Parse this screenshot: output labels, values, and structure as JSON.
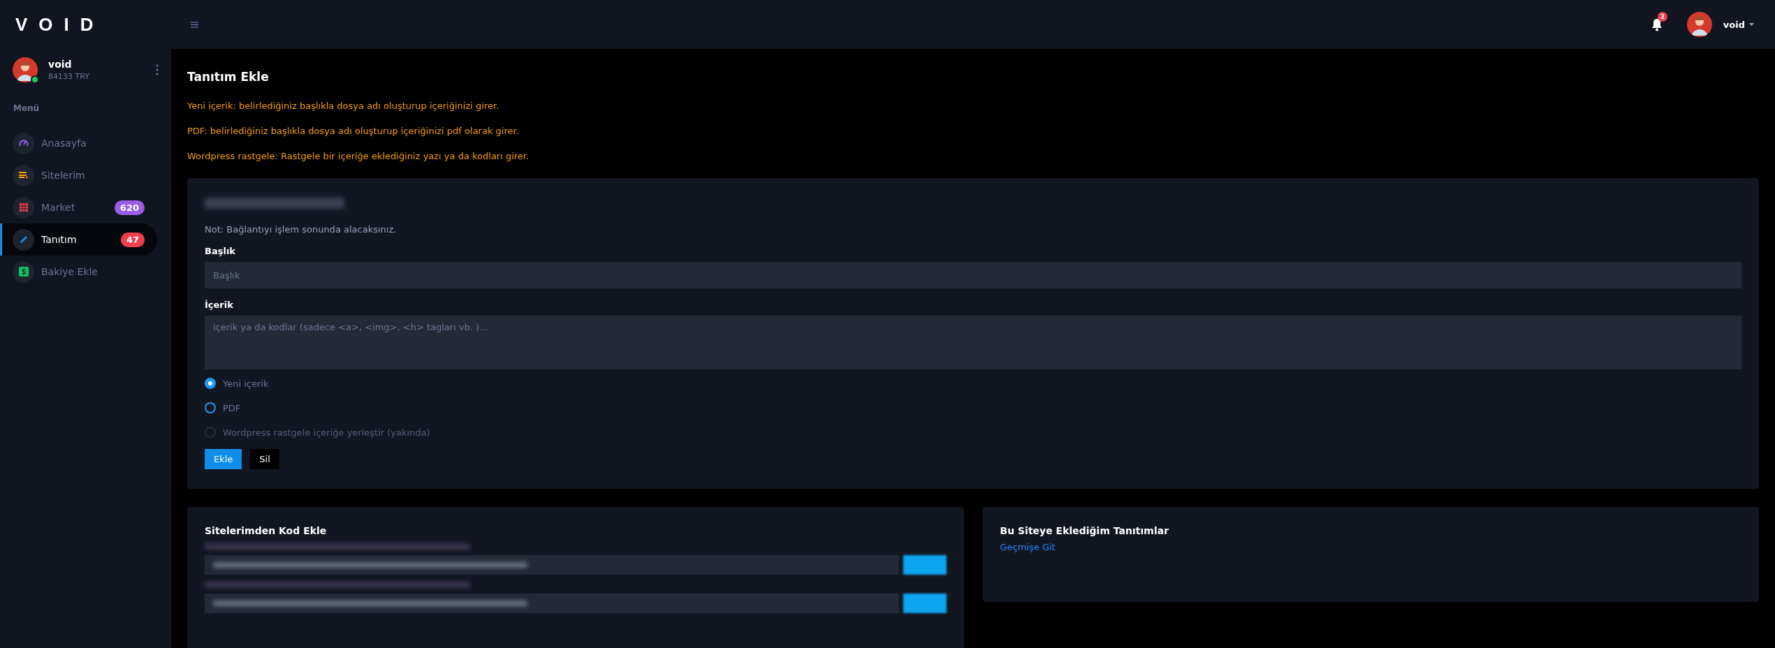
{
  "logo": "VOID",
  "user": {
    "name": "void",
    "balance": "84133 TRY",
    "online": true
  },
  "menu_heading": "Menü",
  "menu": [
    {
      "label": "Anasayfa",
      "selected": false
    },
    {
      "label": "Sitelerim",
      "selected": false
    },
    {
      "label": "Market",
      "selected": false,
      "badge": "620",
      "color": "#9b5de5"
    },
    {
      "label": "Tanıtım",
      "selected": true,
      "badge": "47",
      "color": "#f03e4e"
    },
    {
      "label": "Bakiye Ekle",
      "selected": false
    }
  ],
  "topbar": {
    "notifications": "2",
    "user_name": "void"
  },
  "page_title": "Tanıtım Ekle",
  "notes": [
    "Yeni içerik: belirlediğiniz başlıkla dosya adı oluşturup içeriğinizi girer.",
    "PDF: belirlediğiniz başlıkla dosya adı oluşturup içeriğinizi pdf olarak girer.",
    "Wordpress rastgele: Rastgele bir içeriğe eklediğiniz yazı ya da kodları girer."
  ],
  "form": {
    "note": "Not: Bağlantıyı işlem sonunda alacaksınız.",
    "title_label": "Başlık",
    "title_placeholder": "Başlık",
    "content_label": "İçerik",
    "content_placeholder": "içerik ya da kodlar (sadece <a>, <img>, <h> tagları vb. )...",
    "options": [
      {
        "label": "Yeni içerik",
        "selected": true,
        "disabled": false
      },
      {
        "label": "PDF",
        "selected": false,
        "disabled": false
      },
      {
        "label": "Wordpress rastgele içeriğe yerleştir (yakında)",
        "selected": false,
        "disabled": true
      }
    ],
    "buttons": [
      {
        "label": "Ekle",
        "kind": "primary"
      },
      {
        "label": "Sil",
        "kind": "dark"
      }
    ]
  },
  "code_panel": {
    "title": "Sitelerimden Kod Ekle"
  },
  "history_panel": {
    "title": "Bu Siteye Eklediğim Tanıtımlar",
    "link": "Geçmişe Git"
  }
}
